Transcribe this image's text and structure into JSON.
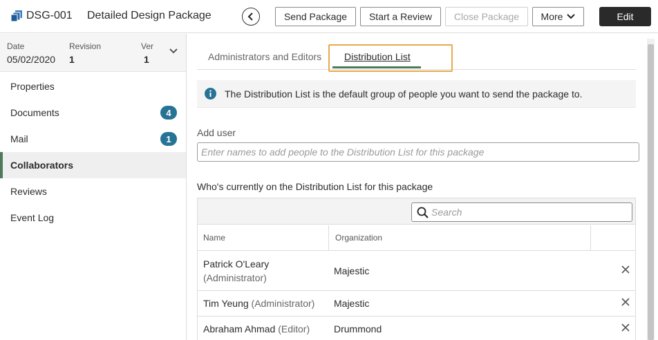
{
  "header": {
    "package_id": "DSG-001",
    "package_title": "Detailed Design Package",
    "buttons": {
      "send": "Send Package",
      "review": "Start a Review",
      "close": "Close Package",
      "more": "More",
      "edit": "Edit"
    }
  },
  "sidebar": {
    "meta": {
      "date_label": "Date",
      "date_value": "05/02/2020",
      "revision_label": "Revision",
      "revision_value": "1",
      "ver_label": "Ver",
      "ver_value": "1"
    },
    "items": [
      {
        "label": "Properties"
      },
      {
        "label": "Documents",
        "badge": "4"
      },
      {
        "label": "Mail",
        "badge": "1"
      },
      {
        "label": "Collaborators"
      },
      {
        "label": "Reviews"
      },
      {
        "label": "Event Log"
      }
    ]
  },
  "main": {
    "tabs": [
      {
        "label": "Administrators and Editors"
      },
      {
        "label": "Distribution List"
      }
    ],
    "info_text": "The Distribution List is the default group of people you want to send the package to.",
    "add_user_label": "Add user",
    "add_user_placeholder": "Enter names to add people to the Distribution List for this package",
    "list_label": "Who's currently on the Distribution List for this package",
    "search_placeholder": "Search",
    "columns": {
      "name": "Name",
      "organization": "Organization"
    },
    "rows": [
      {
        "name": "Patrick O'Leary",
        "role": "Administrator",
        "organization": "Majestic"
      },
      {
        "name": "Tim Yeung",
        "role": "Administrator",
        "organization": "Majestic"
      },
      {
        "name": "Abraham Ahmad",
        "role": "Editor",
        "organization": "Drummond"
      }
    ]
  },
  "colors": {
    "accent_green": "#4e7a5a",
    "badge_blue": "#267396",
    "highlight_orange": "#e8a94c",
    "primary_dark": "#2a2a2a"
  }
}
